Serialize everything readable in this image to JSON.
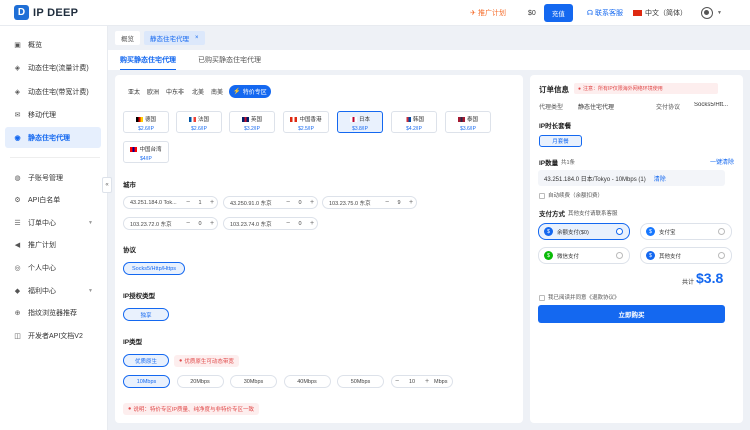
{
  "header": {
    "logo_mark": "D",
    "logo_text": "IP DEEP",
    "promo": "推广计划",
    "balance": "$0",
    "recharge": "充值",
    "support": "联系客服",
    "language": "中文（简体）"
  },
  "sidebar": {
    "items": [
      {
        "label": "概览",
        "icon": "overview-icon"
      },
      {
        "label": "动态住宅(流量计费)",
        "icon": "dynamic-residential-icon"
      },
      {
        "label": "动态住宅(带宽计费)",
        "icon": "dynamic-bandwidth-icon"
      },
      {
        "label": "移动代理",
        "icon": "mobile-proxy-icon"
      },
      {
        "label": "静态住宅代理",
        "icon": "static-residential-icon"
      },
      {
        "label": "子账号管理",
        "icon": "sub-account-icon"
      },
      {
        "label": "API白名单",
        "icon": "api-whitelist-icon"
      },
      {
        "label": "订单中心",
        "icon": "order-icon"
      },
      {
        "label": "推广计划",
        "icon": "promo-icon"
      },
      {
        "label": "个人中心",
        "icon": "user-icon"
      },
      {
        "label": "福利中心",
        "icon": "gift-icon"
      },
      {
        "label": "指纹浏览器推荐",
        "icon": "fingerprint-icon"
      },
      {
        "label": "开发者API文档V2",
        "icon": "api-doc-icon"
      }
    ]
  },
  "page_tabs": [
    "概览",
    "静态住宅代理"
  ],
  "sub_tabs": [
    "购买静态住宅代理",
    "已购买静态住宅代理"
  ],
  "regions": [
    "亚太",
    "欧洲",
    "中东非",
    "北美",
    "南美"
  ],
  "special_region": "特价专区",
  "countries": [
    {
      "name": "德国",
      "price": "$2.6/IP",
      "c1": "#000000",
      "c2": "#dd0000",
      "c3": "#ffce00"
    },
    {
      "name": "法国",
      "price": "$2.6/IP",
      "c1": "#0055a4",
      "c2": "#ffffff",
      "c3": "#ef4135"
    },
    {
      "name": "英国",
      "price": "$3.2/IP",
      "c1": "#012169",
      "c2": "#c8102e",
      "c3": "#012169"
    },
    {
      "name": "中国香港",
      "price": "$2.5/IP",
      "c1": "#de2910",
      "c2": "#ffffff",
      "c3": "#de2910"
    },
    {
      "name": "日本",
      "price": "$3.8/IP",
      "c1": "#ffffff",
      "c2": "#bc002d",
      "c3": "#ffffff"
    },
    {
      "name": "韩国",
      "price": "$4.2/IP",
      "c1": "#ffffff",
      "c2": "#cd2e3a",
      "c3": "#0047a0"
    },
    {
      "name": "泰国",
      "price": "$3.6/IP",
      "c1": "#a51931",
      "c2": "#2d2a4a",
      "c3": "#a51931"
    },
    {
      "name": "中国台湾",
      "price": "$4/IP",
      "c1": "#fe0000",
      "c2": "#000095",
      "c3": "#fe0000"
    }
  ],
  "labels": {
    "city": "城市",
    "protocol": "协议",
    "auth": "IP授权类型",
    "iptype": "IP类型"
  },
  "cities": [
    {
      "name": "43.251.184.0 Tok...",
      "qty": "1"
    },
    {
      "name": "43.250.91.0 东京",
      "qty": "0"
    },
    {
      "name": "103.23.75.0 东京",
      "qty": "9"
    },
    {
      "name": "103.23.72.0 东京",
      "qty": "0"
    },
    {
      "name": "103.23.74.0 东京",
      "qty": "0"
    }
  ],
  "protocol": "Socks5/Http/Https",
  "auth_type": "独享",
  "ip_type": "优质原生",
  "ip_type_note": "优质原生可动态带宽",
  "bandwidths": [
    "10Mbps",
    "20Mbps",
    "30Mbps",
    "40Mbps",
    "50Mbps"
  ],
  "custom_bw": {
    "value": "10",
    "unit": "Mbps"
  },
  "footnote": "说明：特价专区IP质量、纯净度与非特价专区一致",
  "order": {
    "title": "订单信息",
    "notice": "注意：所有IP仅限海外网络环境使用",
    "proxy_type_label": "代理类型",
    "proxy_type_value": "静态住宅代理",
    "protocol_label": "交付协议",
    "protocol_value": "Socks5/Htt...",
    "duration_label": "IP时长套餐",
    "duration_value": "月套餐",
    "ip_qty_label": "IP数量",
    "ip_qty_count": "共1条",
    "clear_all": "一键清除",
    "selected_ip": "43.251.184.0 日本/Tokyo - 10Mbps (1)",
    "clear": "清除",
    "auto_renew": "自动续费（余额扣费）",
    "pay_label": "支付方式",
    "pay_contact": "其他支付请联系客服",
    "pay_methods": [
      {
        "name": "余额支付($0)",
        "icon": "wallet-icon",
        "color": "#1468f0"
      },
      {
        "name": "支付宝",
        "icon": "alipay-icon",
        "color": "#1677ff"
      },
      {
        "name": "微信支付",
        "icon": "wechat-icon",
        "color": "#09bb07"
      },
      {
        "name": "其他支付",
        "icon": "card-icon",
        "color": "#1468f0"
      }
    ],
    "total_label": "共计",
    "total_value": "$3.8",
    "agree": "我已阅读并同意《退款协议》",
    "buy": "立即购买"
  }
}
